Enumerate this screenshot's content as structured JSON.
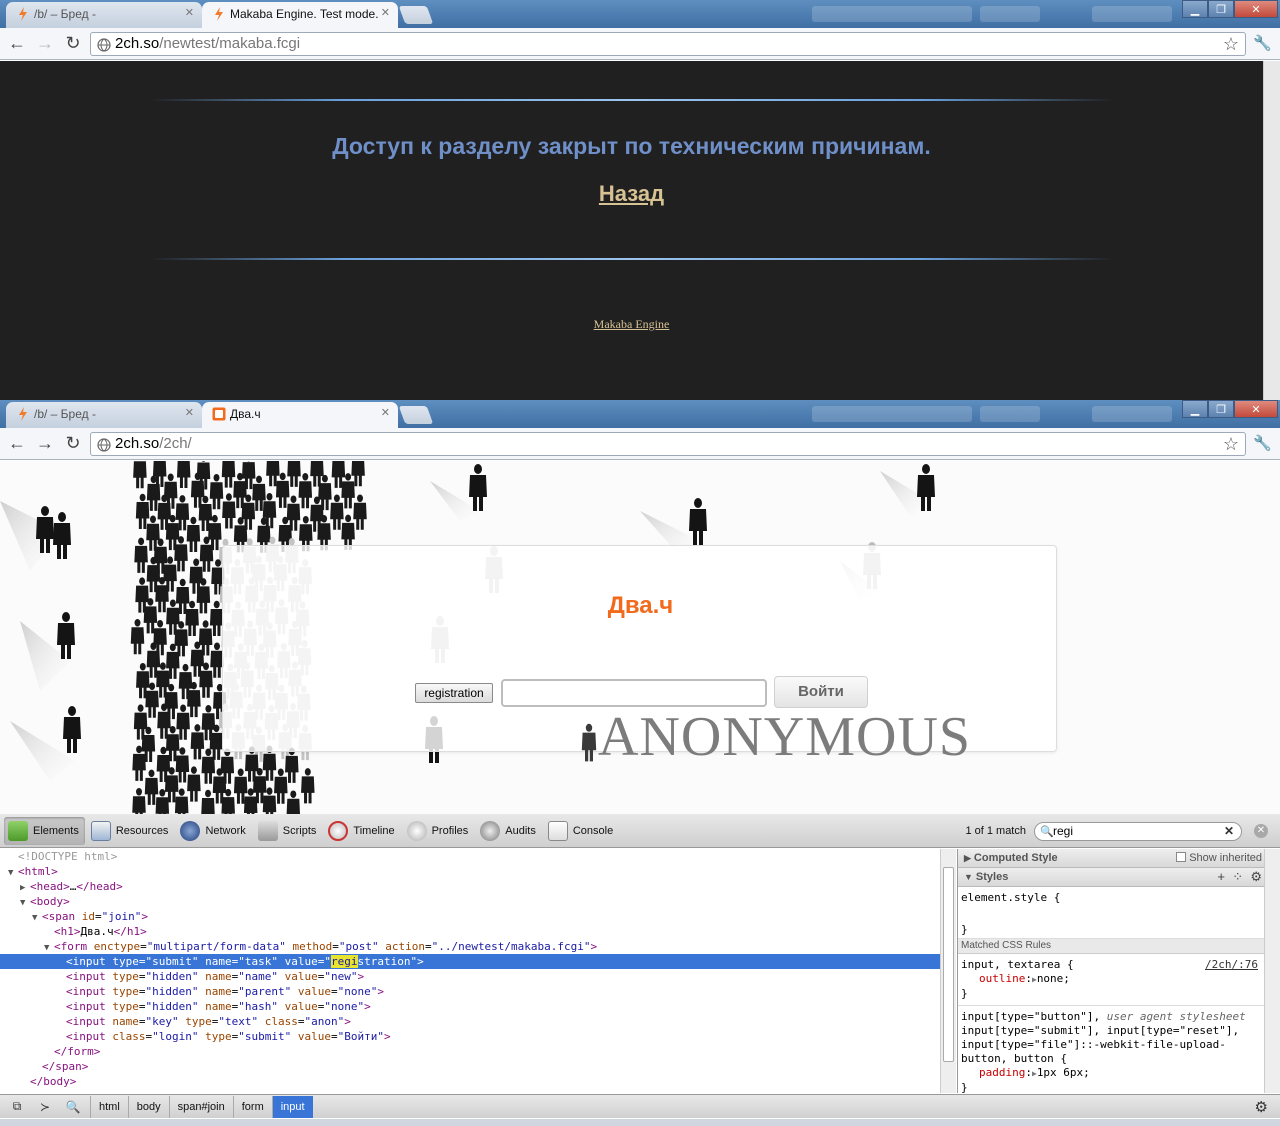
{
  "window_top": {
    "tabs": [
      {
        "title": "/b/ – Бред -",
        "active": false
      },
      {
        "title": "Makaba Engine. Test mode.",
        "active": true
      }
    ],
    "url_host": "2ch.so",
    "url_path": "/newtest/makaba.fcgi",
    "message": "Доступ к разделу закрыт по техническим причинам.",
    "back_link": "Назад",
    "footer_link": "Makaba Engine"
  },
  "window_bottom": {
    "tabs": [
      {
        "title": "/b/ – Бред -",
        "active": false
      },
      {
        "title": "Два.ч",
        "active": true
      }
    ],
    "url_host": "2ch.so",
    "url_path": "/2ch/",
    "site_title": "Два.ч",
    "registration_button": "registration",
    "login_input_value": "",
    "login_button": "Войти",
    "banner_text": "ANONYMOUS"
  },
  "devtools": {
    "tabs": [
      "Elements",
      "Resources",
      "Network",
      "Scripts",
      "Timeline",
      "Profiles",
      "Audits",
      "Console"
    ],
    "selected_tab": "Elements",
    "match_count": "1 of 1 match",
    "search_value": "regi",
    "dom": {
      "doctype": "<!DOCTYPE html>",
      "html_open": "html",
      "head_collapsed": "head",
      "head_ellipsis": "…",
      "body": "body",
      "span_tag": "span",
      "span_id": "join",
      "h1_text": "Два.ч",
      "form_enctype": "multipart/form-data",
      "form_method": "post",
      "form_action": "../newtest/makaba.fcgi",
      "inputs": [
        {
          "a1": "type",
          "v1": "submit",
          "a2": "name",
          "v2": "task",
          "a3": "value",
          "v3": "registration"
        },
        {
          "a1": "type",
          "v1": "hidden",
          "a2": "name",
          "v2": "name",
          "a3": "value",
          "v3": "new"
        },
        {
          "a1": "type",
          "v1": "hidden",
          "a2": "name",
          "v2": "parent",
          "a3": "value",
          "v3": "none"
        },
        {
          "a1": "type",
          "v1": "hidden",
          "a2": "name",
          "v2": "hash",
          "a3": "value",
          "v3": "none"
        },
        {
          "a1": "name",
          "v1": "key",
          "a2": "type",
          "v2": "text",
          "a3": "class",
          "v3": "anon"
        },
        {
          "a1": "class",
          "v1": "login",
          "a2": "type",
          "v2": "submit",
          "a3": "value",
          "v3": "Войти"
        }
      ]
    },
    "styles": {
      "computed_style": "Computed Style",
      "show_inherited": "Show inherited",
      "styles_header": "Styles",
      "element_style": "element.style {",
      "matched_rules": "Matched CSS Rules",
      "rule1_selector": "input, textarea {",
      "rule1_source": "/2ch/:76",
      "rule1_prop": "outline",
      "rule1_value": "none;",
      "rule2_selector_a": "input[type=\"button\"],",
      "rule2_origin": "user agent stylesheet",
      "rule2_selector_b": "input[type=\"submit\"], input[type=\"reset\"],",
      "rule2_selector_c": "input[type=\"file\"]::-webkit-file-upload-",
      "rule2_selector_d": "button, button {",
      "rule2_prop": "padding",
      "rule2_value": "1px 6px;"
    },
    "breadcrumbs": [
      "html",
      "body",
      "span#join",
      "form",
      "input"
    ],
    "selected_crumb": "input"
  }
}
